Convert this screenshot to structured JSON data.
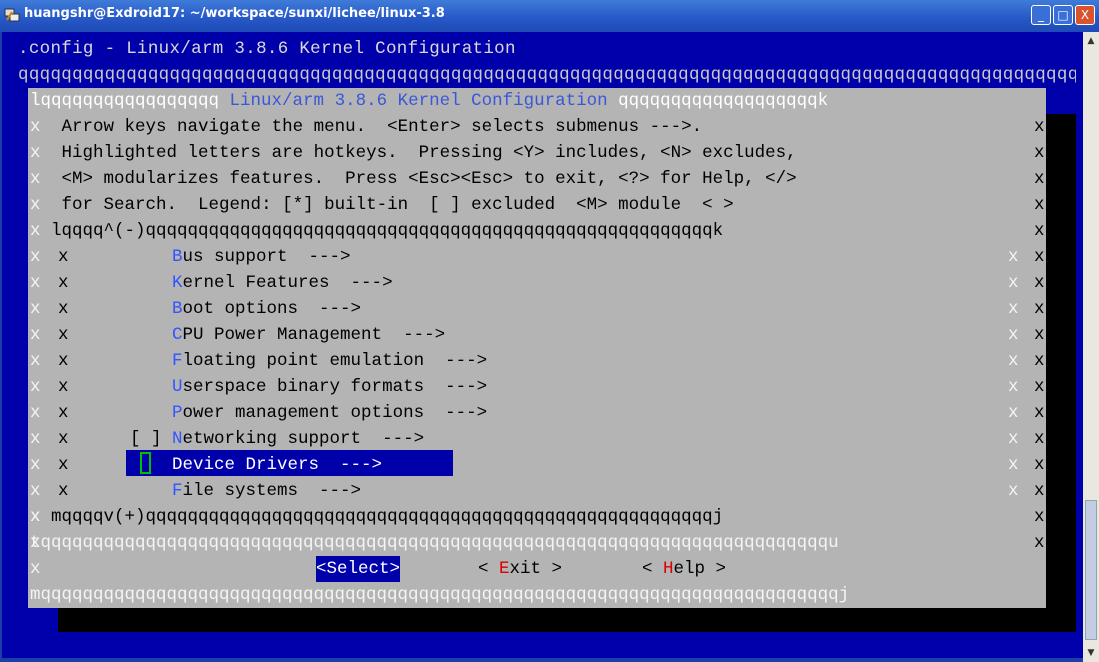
{
  "window": {
    "title": "huangshr@Exdroid17: ~/workspace/sunxi/lichee/linux-3.8",
    "buttons": {
      "minimize": "_",
      "maximize": "□",
      "close": "X"
    }
  },
  "terminal": {
    "config_line": ".config - Linux/arm 3.8.6 Kernel Configuration",
    "q_line": "qqqqqqqqqqqqqqqqqqqqqqqqqqqqqqqqqqqqqqqqqqqqqqqqqqqqqqqqqqqqqqqqqqqqqqqqqqqqqqqqqqqqqqqqqqqqqqqqqq"
  },
  "dialog": {
    "title_left": "lqqqqqqqqqqqqqqqqq ",
    "title": "Linux/arm 3.8.6 Kernel Configuration",
    "title_right": " qqqqqqqqqqqqqqqqqqqk",
    "help": [
      "Arrow keys navigate the menu.  <Enter> selects submenus --->.",
      "Highlighted letters are hotkeys.  Pressing <Y> includes, <N> excludes,",
      "<M> modularizes features.  Press <Esc><Esc> to exit, <?> for Help, </>",
      "for Search.  Legend: [*] built-in  [ ] excluded  <M> module  < >"
    ],
    "menu_top_border": "lqqqq^(-)qqqqqqqqqqqqqqqqqqqqqqqqqqqqqqqqqqqqqqqqqqqqqqqqqqqqqqk",
    "menu_bottom_border": "mqqqqv(+)qqqqqqqqqqqqqqqqqqqqqqqqqqqqqqqqqqqqqqqqqqqqqqqqqqqqqqj",
    "separator": "tqqqqqqqqqqqqqqqqqqqqqqqqqqqqqqqqqqqqqqqqqqqqqqqqqqqqqqqqqqqqqqqqqqqqqqqqqqqu",
    "bottom_border": "mqqqqqqqqqqqqqqqqqqqqqqqqqqqqqqqqqqqqqqqqqqqqqqqqqqqqqqqqqqqqqqqqqqqqqqqqqqqqj",
    "menu_items": [
      {
        "prefix": "    ",
        "hotkey": "B",
        "rest": "us support  --->"
      },
      {
        "prefix": "    ",
        "hotkey": "K",
        "rest": "ernel Features  --->"
      },
      {
        "prefix": "    ",
        "hotkey": "B",
        "rest": "oot options  --->"
      },
      {
        "prefix": "    ",
        "hotkey": "C",
        "rest": "PU Power Management  --->"
      },
      {
        "prefix": "    ",
        "hotkey": "F",
        "rest": "loating point emulation  --->"
      },
      {
        "prefix": "    ",
        "hotkey": "U",
        "rest": "serspace binary formats  --->"
      },
      {
        "prefix": "    ",
        "hotkey": "P",
        "rest": "ower management options  --->"
      },
      {
        "prefix": "[ ] ",
        "hotkey": "N",
        "rest": "etworking support  --->",
        "hotkey_before": "N",
        "after_hotkey": "e"
      },
      {
        "prefix": "    ",
        "hotkey": "",
        "rest": "Device Drivers  --->",
        "selected": true
      },
      {
        "prefix": "    ",
        "hotkey": "F",
        "rest": "ile systems  --->"
      }
    ],
    "buttons": {
      "select": "<Select>",
      "exit_pre": "< ",
      "exit_hot": "E",
      "exit_rest": "xit >",
      "help_pre": "< ",
      "help_hot": "H",
      "help_rest": "elp >"
    }
  },
  "colors": {
    "terminal_bg": "#0000ab",
    "dialog_bg": "#b4b4b4",
    "hotkey": "#3355ff",
    "exit_hotkey": "#dd0000"
  }
}
